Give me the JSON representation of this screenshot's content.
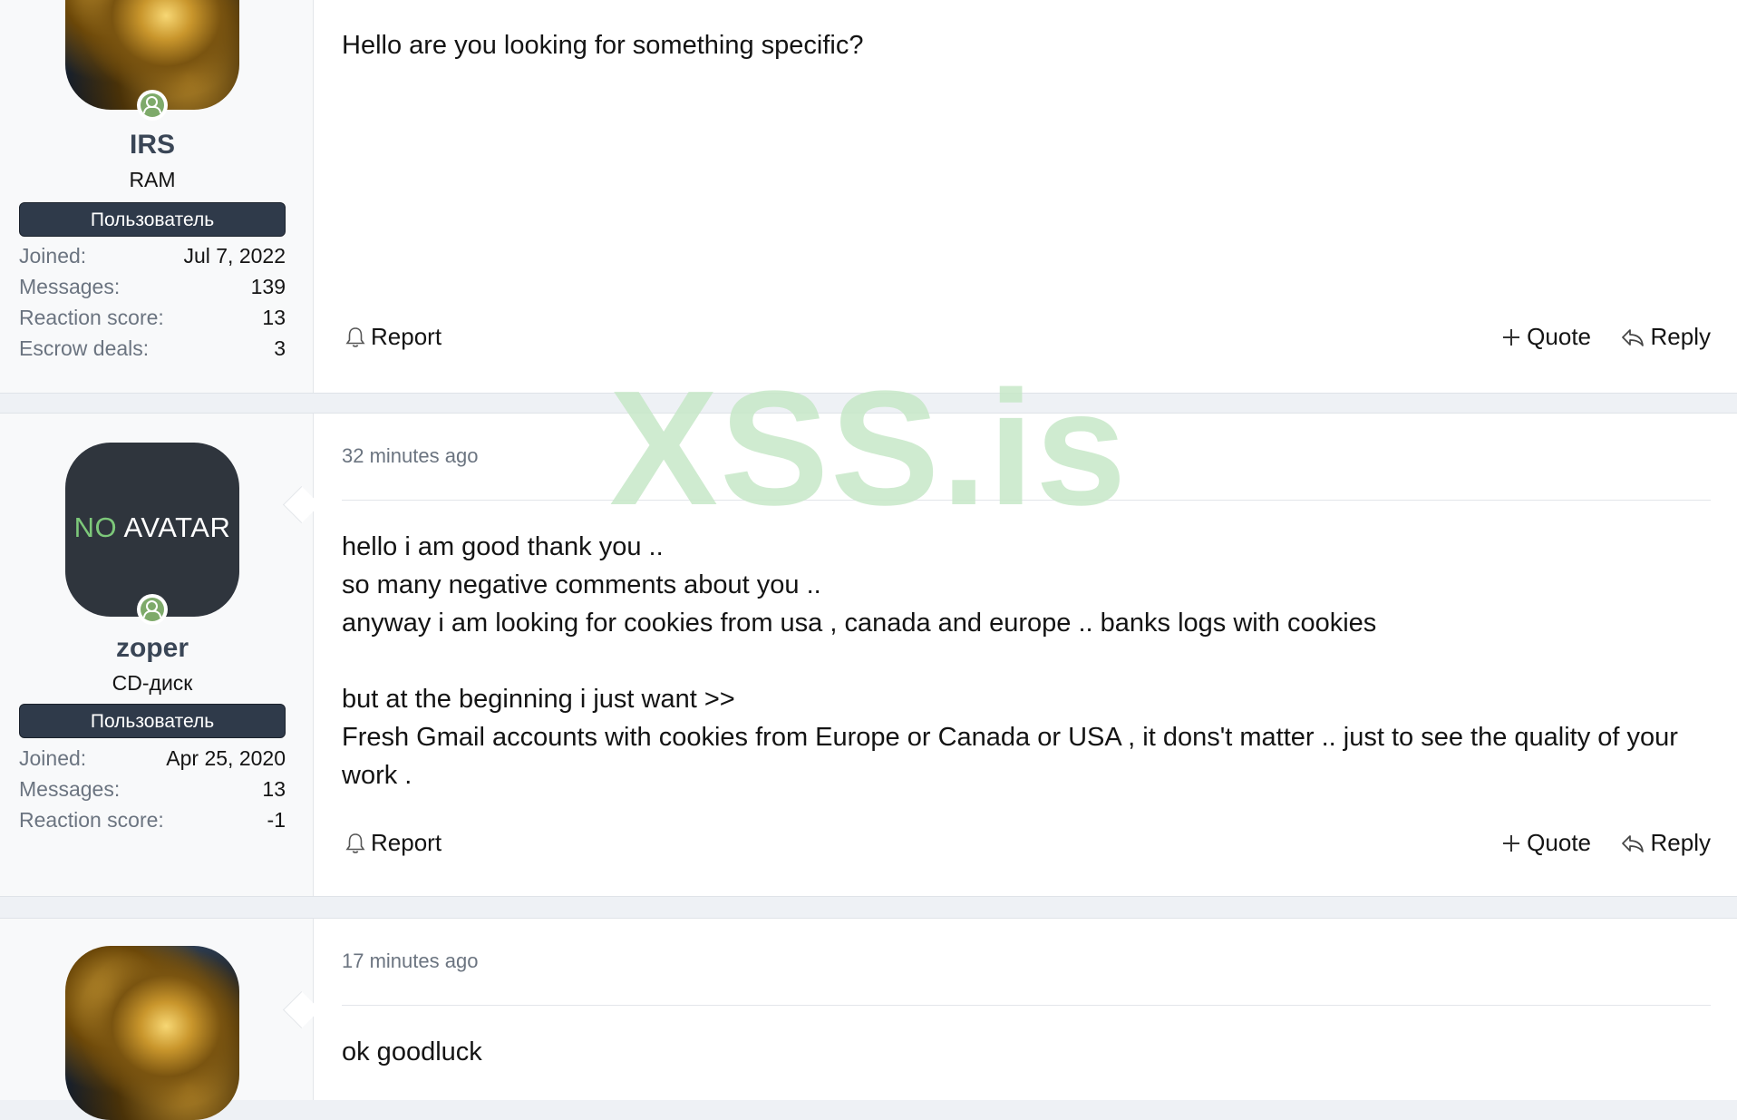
{
  "watermark": "XSS.is",
  "posts": [
    {
      "author": {
        "avatar": "bull-avatar",
        "name": "IRS",
        "title": "RAM",
        "banner": "Пользователь",
        "stats": [
          {
            "label": "Joined:",
            "value": "Jul 7, 2022"
          },
          {
            "label": "Messages:",
            "value": "139"
          },
          {
            "label": "Reaction score:",
            "value": "13"
          },
          {
            "label": "Escrow deals:",
            "value": "3"
          }
        ]
      },
      "date": "",
      "body": [
        "Hello are you looking for something specific?"
      ],
      "actions": {
        "report": "Report",
        "quote": "Quote",
        "reply": "Reply"
      }
    },
    {
      "author": {
        "avatar": "no-avatar",
        "avatar_text_no": "NO",
        "avatar_text_rest": " AVATAR",
        "name": "zoper",
        "title": "CD-диск",
        "banner": "Пользователь",
        "stats": [
          {
            "label": "Joined:",
            "value": "Apr 25, 2020"
          },
          {
            "label": "Messages:",
            "value": "13"
          },
          {
            "label": "Reaction score:",
            "value": "-1"
          }
        ]
      },
      "date": "32 minutes ago",
      "body": [
        "hello i am good thank you ..",
        "so many negative comments about you ..",
        "anyway i am looking for cookies from usa , canada and europe .. banks logs with cookies",
        "",
        "but at the beginning i just want >>",
        "Fresh Gmail accounts with cookies from Europe or Canada or USA , it dons't matter .. just to see the quality of your work ."
      ],
      "actions": {
        "report": "Report",
        "quote": "Quote",
        "reply": "Reply"
      }
    },
    {
      "author": {
        "avatar": "bull-avatar"
      },
      "date": "17 minutes ago",
      "body": [
        "ok goodluck"
      ]
    }
  ],
  "colors": {
    "banner": "#2f3a4a",
    "online": "#7eaa6a",
    "watermark": "#c7e8c8",
    "username": "#3a4656"
  }
}
